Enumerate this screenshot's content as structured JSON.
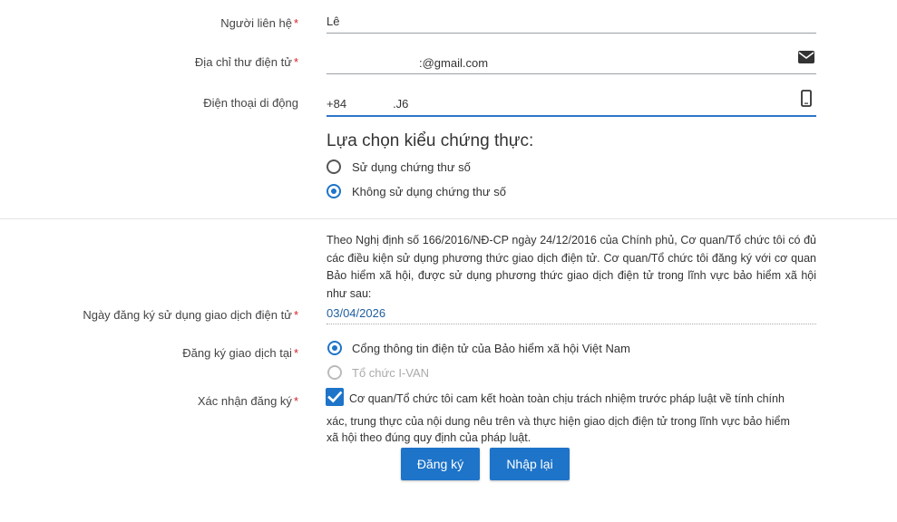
{
  "contact": {
    "label": "Người liên hệ",
    "required": "*",
    "value": "Lê"
  },
  "email": {
    "label": "Địa chỉ thư điện tử",
    "required": "*",
    "value": ":@gmail.com",
    "icon": "envelope-icon"
  },
  "phone": {
    "label": "Điện thoại di động",
    "prefix": "+84",
    "value": ".J6",
    "icon": "mobile-phone-icon"
  },
  "auth": {
    "heading": "Lựa chọn kiểu chứng thực:",
    "options": [
      {
        "label": "Sử dụng chứng thư số",
        "selected": false
      },
      {
        "label": "Không sử dụng chứng thư số",
        "selected": true
      }
    ]
  },
  "notice": {
    "text": "Theo Nghị định số 166/2016/NĐ-CP ngày 24/12/2016 của Chính phủ, Cơ quan/Tổ chức tôi có đủ các điều kiện sử dụng phương thức giao dịch điện tử. Cơ quan/Tổ chức tôi đăng ký với cơ quan Bảo hiểm xã hội, được sử dụng phương thức giao dịch điện tử trong lĩnh vực bảo hiểm xã hội như sau:"
  },
  "reg_date": {
    "label": "Ngày đăng ký sử dụng giao dịch điện tử",
    "required": "*",
    "value": "03/04/2026",
    "value_color": "#1f5f9e"
  },
  "reg_at": {
    "label": "Đăng ký giao dịch tại",
    "required": "*",
    "options": [
      {
        "label": "Cổng thông tin điện tử của Bảo hiểm xã hội Việt Nam",
        "selected": true,
        "disabled": false
      },
      {
        "label": "Tổ chức I-VAN",
        "selected": false,
        "disabled": true
      }
    ]
  },
  "confirm": {
    "label": "Xác nhận đăng ký",
    "required": "*",
    "checked": true,
    "line1": "Cơ quan/Tổ chức tôi cam kết hoàn toàn chịu trách nhiệm trước pháp luật về tính chính",
    "line2": "xác, trung thực của nội dung nêu trên và thực hiện giao dịch điện tử trong lĩnh vực bảo hiểm",
    "line3": "xã hội theo đúng quy định của pháp luật."
  },
  "buttons": {
    "register": "Đăng ký",
    "reset": "Nhập lại"
  },
  "colors": {
    "accent": "#1e74c9",
    "required": "#d9232d"
  }
}
